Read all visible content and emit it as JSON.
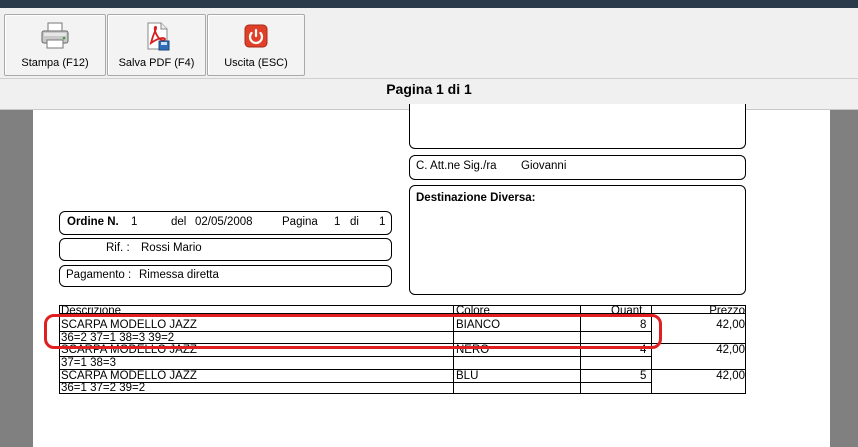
{
  "toolbar": {
    "print_label": "Stampa (F12)",
    "pdf_label": "Salva PDF (F4)",
    "exit_label": "Uscita (ESC)"
  },
  "page_indicator": "Pagina 1 di 1",
  "document": {
    "attention_label": "C. Att.ne Sig./ra",
    "attention_name": "Giovanni",
    "destination_label": "Destinazione Diversa:",
    "order_label": "Ordine N.",
    "order_number": "1",
    "order_date_label": "del",
    "order_date": "02/05/2008",
    "page_label": "Pagina",
    "page_num": "1",
    "page_of_label": "di",
    "page_total": "1",
    "ref_label": "Rif. :",
    "ref_value": "Rossi Mario",
    "payment_label": "Pagamento :",
    "payment_value": "Rimessa diretta"
  },
  "table": {
    "headers": {
      "description": "Descrizione",
      "color": "Colore",
      "quantity": "Quant.",
      "price": "Prezzo"
    },
    "rows": [
      {
        "description": "SCARPA MODELLO JAZZ",
        "color": "BIANCO",
        "quantity": "8",
        "price": "42,00",
        "sizes": "36=2  37=1  38=3  39=2"
      },
      {
        "description": "SCARPA MODELLO JAZZ",
        "color": "NERO",
        "quantity": "4",
        "price": "42,00",
        "sizes": "37=1  38=3"
      },
      {
        "description": "SCARPA MODELLO JAZZ",
        "color": "BLU",
        "quantity": "5",
        "price": "42,00",
        "sizes": "36=1  37=2  39=2"
      }
    ]
  },
  "colors": {
    "highlight": "#e02020",
    "pdf_red": "#d62020",
    "exit_red": "#e04028"
  }
}
